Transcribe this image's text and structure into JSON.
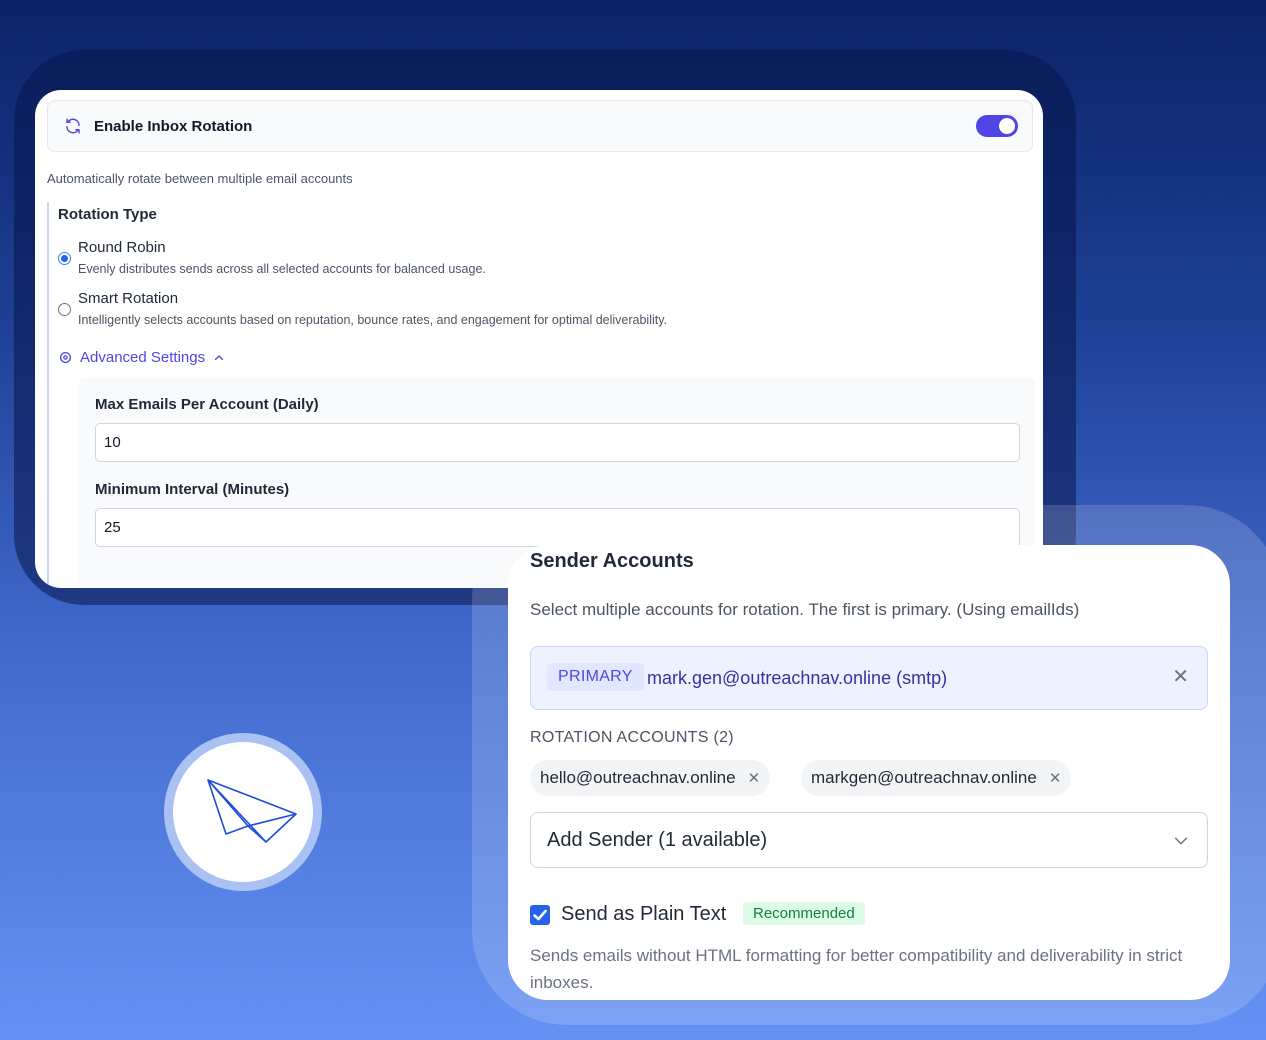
{
  "inbox_rotation": {
    "toggle_label": "Enable Inbox Rotation",
    "enabled": true,
    "description": "Automatically rotate between multiple email accounts",
    "rotation_type_title": "Rotation Type",
    "options": [
      {
        "label": "Round Robin",
        "description": "Evenly distributes sends across all selected accounts for balanced usage.",
        "selected": true
      },
      {
        "label": "Smart Rotation",
        "description": "Intelligently selects accounts based on reputation, bounce rates, and engagement for optimal deliverability.",
        "selected": false
      }
    ],
    "advanced_settings_label": "Advanced Settings",
    "max_emails_label": "Max Emails Per Account (Daily)",
    "max_emails_value": "10",
    "min_interval_label": "Minimum Interval (Minutes)",
    "min_interval_value": "25"
  },
  "sender_accounts": {
    "title": "Sender Accounts",
    "description": "Select multiple accounts for rotation. The first is primary. (Using emailIds)",
    "primary_badge": "PRIMARY",
    "primary_email": "mark.gen@outreachnav.online (smtp)",
    "rotation_accounts_label": "ROTATION ACCOUNTS (2)",
    "rotation_accounts": [
      "hello@outreachnav.online",
      "markgen@outreachnav.online"
    ],
    "add_sender_placeholder": "Add Sender (1 available)",
    "plain_text_label": "Send as Plain Text",
    "plain_text_checked": true,
    "recommended_badge": "Recommended",
    "plain_text_description": "Sends emails without HTML formatting for better compatibility and deliverability in strict inboxes."
  },
  "icons": {
    "rotation": "refresh-icon",
    "advanced": "gear-icon",
    "plane": "paper-plane-icon"
  },
  "colors": {
    "accent": "#4f46e5",
    "checkbox": "#2563eb",
    "recommended_bg": "#dcfce7",
    "recommended_text": "#15803d"
  }
}
